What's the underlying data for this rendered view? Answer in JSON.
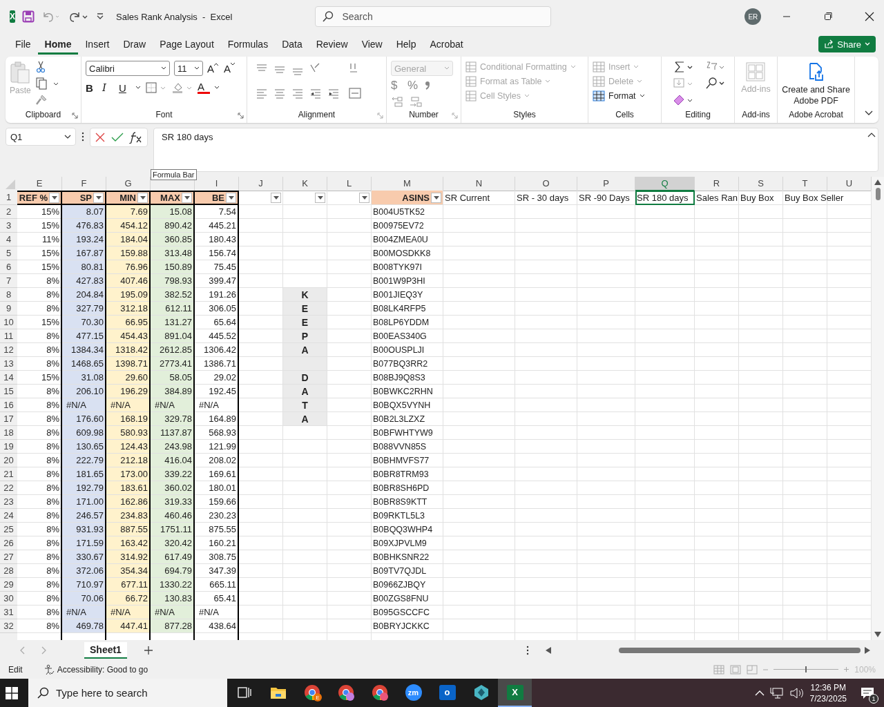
{
  "title_bar": {
    "app_glyph": "X",
    "title": "Sales Rank Analysis  -  Excel",
    "search": {
      "placeholder": "Search"
    },
    "avatar": "ER"
  },
  "menu": {
    "tabs": [
      {
        "label": "File",
        "selected": false
      },
      {
        "label": "Home",
        "selected": true
      },
      {
        "label": "Insert",
        "selected": false
      },
      {
        "label": "Draw",
        "selected": false
      },
      {
        "label": "Page Layout",
        "selected": false
      },
      {
        "label": "Formulas",
        "selected": false
      },
      {
        "label": "Data",
        "selected": false
      },
      {
        "label": "Review",
        "selected": false
      },
      {
        "label": "View",
        "selected": false
      },
      {
        "label": "Help",
        "selected": false
      },
      {
        "label": "Acrobat",
        "selected": false
      }
    ],
    "share": "Share"
  },
  "ribbon": {
    "clipboard": {
      "label": "Clipboard",
      "paste": {
        "label": "Paste",
        "disabled": true
      }
    },
    "font": {
      "label": "Font",
      "family": "Calibri",
      "size": "11",
      "grow": "A",
      "shrink": "A",
      "styles": [
        "B",
        "I",
        "U"
      ],
      "color_letter": "A"
    },
    "alignment": {
      "label": "Alignment"
    },
    "number": {
      "label": "Number",
      "format": {
        "value": "General",
        "disabled": true
      },
      "symbols": [
        "$",
        "%"
      ]
    },
    "styles": {
      "label": "Styles",
      "items": [
        {
          "label": "Conditional Formatting",
          "disabled": true
        },
        {
          "label": "Format as Table",
          "disabled": true
        },
        {
          "label": "Cell Styles",
          "disabled": true
        }
      ]
    },
    "cells": {
      "label": "Cells",
      "items": [
        {
          "label": "Insert",
          "disabled": true
        },
        {
          "label": "Delete",
          "disabled": true
        },
        {
          "label": "Format",
          "disabled": false
        }
      ]
    },
    "editing": {
      "label": "Editing"
    },
    "addins": {
      "label": "Add-ins",
      "button": {
        "label": "Add-ins",
        "disabled": true
      }
    },
    "acrobat": {
      "label": "Adobe Acrobat",
      "button": "Create and Share Adobe PDF"
    }
  },
  "formula_bar": {
    "name_box": "Q1",
    "formula": "SR 180 days",
    "tooltip": "Formula Bar"
  },
  "sheet": {
    "columns": [
      {
        "letter": "E",
        "selected": false
      },
      {
        "letter": "F",
        "selected": false
      },
      {
        "letter": "G",
        "selected": false
      },
      {
        "selected": false
      },
      {
        "letter": "I",
        "selected": false
      },
      {
        "letter": "J",
        "selected": false
      },
      {
        "letter": "K",
        "selected": false
      },
      {
        "letter": "L",
        "selected": false
      },
      {
        "letter": "M",
        "selected": false
      },
      {
        "letter": "N",
        "selected": false
      },
      {
        "letter": "O",
        "selected": false
      },
      {
        "letter": "P",
        "selected": false
      },
      {
        "letter": "Q",
        "selected": true
      },
      {
        "letter": "R",
        "selected": false
      },
      {
        "letter": "S",
        "selected": false
      },
      {
        "letter": "T",
        "selected": false
      },
      {
        "letter": "U",
        "selected": false
      }
    ],
    "header_row": {
      "number": "1",
      "cells": [
        {
          "text": "REF %",
          "kind": "orange",
          "filter": true,
          "selected": false
        },
        {
          "text": "SP",
          "kind": "orange",
          "filter": true,
          "selected": false
        },
        {
          "text": "MIN",
          "kind": "orange",
          "filter": true,
          "selected": false
        },
        {
          "text": "MAX",
          "kind": "orange",
          "filter": true,
          "selected": false
        },
        {
          "text": "BE",
          "kind": "orange",
          "filter": true,
          "selected": false
        },
        {
          "kind": "plain",
          "filter": true,
          "selected": false
        },
        {
          "kind": "plain",
          "filter": true,
          "selected": false
        },
        {
          "kind": "plain",
          "filter": true,
          "selected": false
        },
        {
          "text": "ASINS",
          "kind": "orange",
          "filter": true,
          "selected": false
        },
        {
          "text": "SR Current",
          "kind": "plain",
          "filter": false,
          "selected": false
        },
        {
          "text": "SR - 30 days",
          "kind": "plain",
          "filter": false,
          "selected": false
        },
        {
          "text": "SR -90 Days",
          "kind": "plain",
          "filter": false,
          "selected": false
        },
        {
          "text": "SR 180 days",
          "kind": "plain",
          "filter": false,
          "selected": true
        },
        {
          "text": "Sales Ran",
          "kind": "plain",
          "filter": false,
          "selected": false
        },
        {
          "text": "Buy Box",
          "kind": "plain",
          "filter": false,
          "selected": false
        },
        {
          "text": "Buy Box Seller",
          "kind": "plain",
          "filter": false,
          "selected": false
        }
      ]
    },
    "rows": [
      {
        "number": "2",
        "ref": "15%",
        "sp": "8.07",
        "min": "7.69",
        "max": "15.08",
        "be": "7.54",
        "asin": "B004U5TK52",
        "error": false,
        "k_shaded": false
      },
      {
        "number": "3",
        "ref": "15%",
        "sp": "476.83",
        "min": "454.12",
        "max": "890.42",
        "be": "445.21",
        "asin": "B00975EV72",
        "error": false,
        "k_shaded": false
      },
      {
        "number": "4",
        "ref": "11%",
        "sp": "193.24",
        "min": "184.04",
        "max": "360.85",
        "be": "180.43",
        "asin": "B004ZMEA0U",
        "error": false,
        "k_shaded": false
      },
      {
        "number": "5",
        "ref": "15%",
        "sp": "167.87",
        "min": "159.88",
        "max": "313.48",
        "be": "156.74",
        "asin": "B00MOSDKK8",
        "error": false,
        "k_shaded": false
      },
      {
        "number": "6",
        "ref": "15%",
        "sp": "80.81",
        "min": "76.96",
        "max": "150.89",
        "be": "75.45",
        "asin": "B008TYK97I",
        "error": false,
        "k_shaded": false
      },
      {
        "number": "7",
        "ref": "8%",
        "sp": "427.83",
        "min": "407.46",
        "max": "798.93",
        "be": "399.47",
        "asin": "B001W9P3HI",
        "error": false,
        "k_shaded": false
      },
      {
        "number": "8",
        "ref": "8%",
        "sp": "204.84",
        "min": "195.09",
        "max": "382.52",
        "be": "191.26",
        "asin": "B001JIEQ3Y",
        "error": false,
        "k_shaded": true,
        "k": "K"
      },
      {
        "number": "9",
        "ref": "8%",
        "sp": "327.79",
        "min": "312.18",
        "max": "612.11",
        "be": "306.05",
        "asin": "B08LK4RFP5",
        "error": false,
        "k_shaded": true,
        "k": "E"
      },
      {
        "number": "10",
        "ref": "15%",
        "sp": "70.30",
        "min": "66.95",
        "max": "131.27",
        "be": "65.64",
        "asin": "B08LP6YDDM",
        "error": false,
        "k_shaded": true,
        "k": "E"
      },
      {
        "number": "11",
        "ref": "8%",
        "sp": "477.15",
        "min": "454.43",
        "max": "891.04",
        "be": "445.52",
        "asin": "B00EAS340G",
        "error": false,
        "k_shaded": true,
        "k": "P"
      },
      {
        "number": "12",
        "ref": "8%",
        "sp": "1384.34",
        "min": "1318.42",
        "max": "2612.85",
        "be": "1306.42",
        "asin": "B00OUSPLJI",
        "error": false,
        "k_shaded": true,
        "k": "A"
      },
      {
        "number": "13",
        "ref": "8%",
        "sp": "1468.65",
        "min": "1398.71",
        "max": "2773.41",
        "be": "1386.71",
        "asin": "B077BQ3RR2",
        "error": false,
        "k_shaded": true
      },
      {
        "number": "14",
        "ref": "15%",
        "sp": "31.08",
        "min": "29.60",
        "max": "58.05",
        "be": "29.02",
        "asin": "B08BJ9Q8S3",
        "error": false,
        "k_shaded": true,
        "k": "D"
      },
      {
        "number": "15",
        "ref": "8%",
        "sp": "206.10",
        "min": "196.29",
        "max": "384.89",
        "be": "192.45",
        "asin": "B0BWKC2RHN",
        "error": false,
        "k_shaded": true,
        "k": "A"
      },
      {
        "number": "16",
        "ref": "8%",
        "sp": "#N/A",
        "min": "#N/A",
        "max": "#N/A",
        "be": "#N/A",
        "asin": "B0BQX5VYNH",
        "error": true,
        "k_shaded": true,
        "k": "T"
      },
      {
        "number": "17",
        "ref": "8%",
        "sp": "176.60",
        "min": "168.19",
        "max": "329.78",
        "be": "164.89",
        "asin": "B0B2L3LZXZ",
        "error": false,
        "k_shaded": true,
        "k": "A"
      },
      {
        "number": "18",
        "ref": "8%",
        "sp": "609.98",
        "min": "580.93",
        "max": "1137.87",
        "be": "568.93",
        "asin": "B0BFWHTYW9",
        "error": false,
        "k_shaded": false
      },
      {
        "number": "19",
        "ref": "8%",
        "sp": "130.65",
        "min": "124.43",
        "max": "243.98",
        "be": "121.99",
        "asin": "B088VVN85S",
        "error": false,
        "k_shaded": false
      },
      {
        "number": "20",
        "ref": "8%",
        "sp": "222.79",
        "min": "212.18",
        "max": "416.04",
        "be": "208.02",
        "asin": "B0BHMVFS77",
        "error": false,
        "k_shaded": false
      },
      {
        "number": "21",
        "ref": "8%",
        "sp": "181.65",
        "min": "173.00",
        "max": "339.22",
        "be": "169.61",
        "asin": "B0BR8TRM93",
        "error": false,
        "k_shaded": false
      },
      {
        "number": "22",
        "ref": "8%",
        "sp": "192.79",
        "min": "183.61",
        "max": "360.02",
        "be": "180.01",
        "asin": "B0BR8SH6PD",
        "error": false,
        "k_shaded": false
      },
      {
        "number": "23",
        "ref": "8%",
        "sp": "171.00",
        "min": "162.86",
        "max": "319.33",
        "be": "159.66",
        "asin": "B0BR8S9KTT",
        "error": false,
        "k_shaded": false
      },
      {
        "number": "24",
        "ref": "8%",
        "sp": "246.57",
        "min": "234.83",
        "max": "460.46",
        "be": "230.23",
        "asin": "B09RKTL5L3",
        "error": false,
        "k_shaded": false
      },
      {
        "number": "25",
        "ref": "8%",
        "sp": "931.93",
        "min": "887.55",
        "max": "1751.11",
        "be": "875.55",
        "asin": "B0BQQ3WHP4",
        "error": false,
        "k_shaded": false
      },
      {
        "number": "26",
        "ref": "8%",
        "sp": "171.59",
        "min": "163.42",
        "max": "320.42",
        "be": "160.21",
        "asin": "B09XJPVLM9",
        "error": false,
        "k_shaded": false
      },
      {
        "number": "27",
        "ref": "8%",
        "sp": "330.67",
        "min": "314.92",
        "max": "617.49",
        "be": "308.75",
        "asin": "B0BHKSNR22",
        "error": false,
        "k_shaded": false
      },
      {
        "number": "28",
        "ref": "8%",
        "sp": "372.06",
        "min": "354.34",
        "max": "694.79",
        "be": "347.39",
        "asin": "B09TV7QJDL",
        "error": false,
        "k_shaded": false
      },
      {
        "number": "29",
        "ref": "8%",
        "sp": "710.97",
        "min": "677.11",
        "max": "1330.22",
        "be": "665.11",
        "asin": "B0966ZJBQY",
        "error": false,
        "k_shaded": false
      },
      {
        "number": "30",
        "ref": "8%",
        "sp": "70.06",
        "min": "66.72",
        "max": "130.83",
        "be": "65.41",
        "asin": "B00ZGS8FNU",
        "error": false,
        "k_shaded": false
      },
      {
        "number": "31",
        "ref": "8%",
        "sp": "#N/A",
        "min": "#N/A",
        "max": "#N/A",
        "be": "#N/A",
        "asin": "B095GSCCFC",
        "error": true,
        "k_shaded": false
      },
      {
        "number": "32",
        "ref": "8%",
        "sp": "469.78",
        "min": "447.41",
        "max": "877.28",
        "be": "438.64",
        "asin": "B0BRYJCKKC",
        "error": false,
        "k_shaded": false
      }
    ]
  },
  "sheet_tabs": [
    {
      "label": "Sheet1",
      "selected": true
    }
  ],
  "status_bar": {
    "mode": "Edit",
    "accessibility": "Accessibility: Good to go",
    "zoom": "100%",
    "zoom_slider": {
      "level": 0.5
    }
  },
  "taskbar": {
    "search": {
      "placeholder": "Type here to search"
    },
    "apps": [
      {
        "kind": "taskview",
        "active": false
      },
      {
        "kind": "folder",
        "active": false
      },
      {
        "kind": "chrome",
        "badge": "E",
        "active": false
      },
      {
        "kind": "chrome-profile",
        "active": false
      },
      {
        "kind": "chrome-person",
        "active": false
      },
      {
        "kind": "zoom",
        "glyph": "zm",
        "active": false
      },
      {
        "kind": "outlook",
        "glyph": "o",
        "active": false
      },
      {
        "kind": "gem",
        "active": false
      },
      {
        "kind": "excel",
        "glyph": "X",
        "active": true
      }
    ],
    "time": "12:36 PM",
    "date": "7/23/2025",
    "notifications": "1"
  }
}
